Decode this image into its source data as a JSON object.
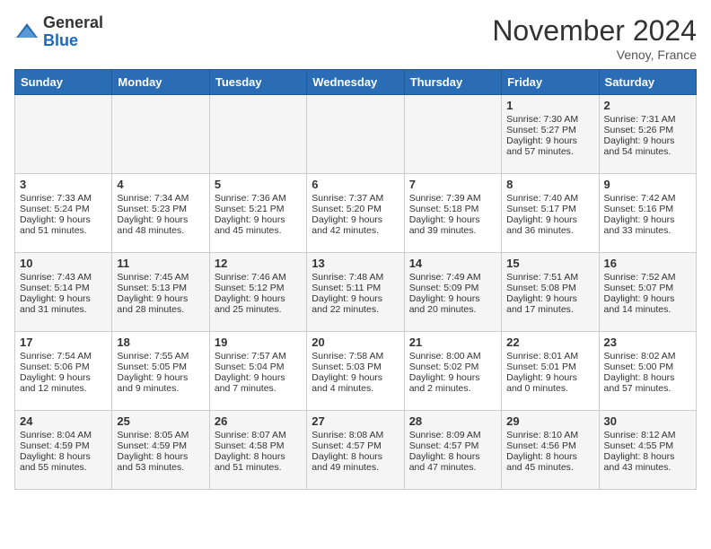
{
  "header": {
    "logo_line1": "General",
    "logo_line2": "Blue",
    "month": "November 2024",
    "location": "Venoy, France"
  },
  "weekdays": [
    "Sunday",
    "Monday",
    "Tuesday",
    "Wednesday",
    "Thursday",
    "Friday",
    "Saturday"
  ],
  "weeks": [
    [
      {
        "day": "",
        "info": ""
      },
      {
        "day": "",
        "info": ""
      },
      {
        "day": "",
        "info": ""
      },
      {
        "day": "",
        "info": ""
      },
      {
        "day": "",
        "info": ""
      },
      {
        "day": "1",
        "info": "Sunrise: 7:30 AM\nSunset: 5:27 PM\nDaylight: 9 hours\nand 57 minutes."
      },
      {
        "day": "2",
        "info": "Sunrise: 7:31 AM\nSunset: 5:26 PM\nDaylight: 9 hours\nand 54 minutes."
      }
    ],
    [
      {
        "day": "3",
        "info": "Sunrise: 7:33 AM\nSunset: 5:24 PM\nDaylight: 9 hours\nand 51 minutes."
      },
      {
        "day": "4",
        "info": "Sunrise: 7:34 AM\nSunset: 5:23 PM\nDaylight: 9 hours\nand 48 minutes."
      },
      {
        "day": "5",
        "info": "Sunrise: 7:36 AM\nSunset: 5:21 PM\nDaylight: 9 hours\nand 45 minutes."
      },
      {
        "day": "6",
        "info": "Sunrise: 7:37 AM\nSunset: 5:20 PM\nDaylight: 9 hours\nand 42 minutes."
      },
      {
        "day": "7",
        "info": "Sunrise: 7:39 AM\nSunset: 5:18 PM\nDaylight: 9 hours\nand 39 minutes."
      },
      {
        "day": "8",
        "info": "Sunrise: 7:40 AM\nSunset: 5:17 PM\nDaylight: 9 hours\nand 36 minutes."
      },
      {
        "day": "9",
        "info": "Sunrise: 7:42 AM\nSunset: 5:16 PM\nDaylight: 9 hours\nand 33 minutes."
      }
    ],
    [
      {
        "day": "10",
        "info": "Sunrise: 7:43 AM\nSunset: 5:14 PM\nDaylight: 9 hours\nand 31 minutes."
      },
      {
        "day": "11",
        "info": "Sunrise: 7:45 AM\nSunset: 5:13 PM\nDaylight: 9 hours\nand 28 minutes."
      },
      {
        "day": "12",
        "info": "Sunrise: 7:46 AM\nSunset: 5:12 PM\nDaylight: 9 hours\nand 25 minutes."
      },
      {
        "day": "13",
        "info": "Sunrise: 7:48 AM\nSunset: 5:11 PM\nDaylight: 9 hours\nand 22 minutes."
      },
      {
        "day": "14",
        "info": "Sunrise: 7:49 AM\nSunset: 5:09 PM\nDaylight: 9 hours\nand 20 minutes."
      },
      {
        "day": "15",
        "info": "Sunrise: 7:51 AM\nSunset: 5:08 PM\nDaylight: 9 hours\nand 17 minutes."
      },
      {
        "day": "16",
        "info": "Sunrise: 7:52 AM\nSunset: 5:07 PM\nDaylight: 9 hours\nand 14 minutes."
      }
    ],
    [
      {
        "day": "17",
        "info": "Sunrise: 7:54 AM\nSunset: 5:06 PM\nDaylight: 9 hours\nand 12 minutes."
      },
      {
        "day": "18",
        "info": "Sunrise: 7:55 AM\nSunset: 5:05 PM\nDaylight: 9 hours\nand 9 minutes."
      },
      {
        "day": "19",
        "info": "Sunrise: 7:57 AM\nSunset: 5:04 PM\nDaylight: 9 hours\nand 7 minutes."
      },
      {
        "day": "20",
        "info": "Sunrise: 7:58 AM\nSunset: 5:03 PM\nDaylight: 9 hours\nand 4 minutes."
      },
      {
        "day": "21",
        "info": "Sunrise: 8:00 AM\nSunset: 5:02 PM\nDaylight: 9 hours\nand 2 minutes."
      },
      {
        "day": "22",
        "info": "Sunrise: 8:01 AM\nSunset: 5:01 PM\nDaylight: 9 hours\nand 0 minutes."
      },
      {
        "day": "23",
        "info": "Sunrise: 8:02 AM\nSunset: 5:00 PM\nDaylight: 8 hours\nand 57 minutes."
      }
    ],
    [
      {
        "day": "24",
        "info": "Sunrise: 8:04 AM\nSunset: 4:59 PM\nDaylight: 8 hours\nand 55 minutes."
      },
      {
        "day": "25",
        "info": "Sunrise: 8:05 AM\nSunset: 4:59 PM\nDaylight: 8 hours\nand 53 minutes."
      },
      {
        "day": "26",
        "info": "Sunrise: 8:07 AM\nSunset: 4:58 PM\nDaylight: 8 hours\nand 51 minutes."
      },
      {
        "day": "27",
        "info": "Sunrise: 8:08 AM\nSunset: 4:57 PM\nDaylight: 8 hours\nand 49 minutes."
      },
      {
        "day": "28",
        "info": "Sunrise: 8:09 AM\nSunset: 4:57 PM\nDaylight: 8 hours\nand 47 minutes."
      },
      {
        "day": "29",
        "info": "Sunrise: 8:10 AM\nSunset: 4:56 PM\nDaylight: 8 hours\nand 45 minutes."
      },
      {
        "day": "30",
        "info": "Sunrise: 8:12 AM\nSunset: 4:55 PM\nDaylight: 8 hours\nand 43 minutes."
      }
    ]
  ]
}
